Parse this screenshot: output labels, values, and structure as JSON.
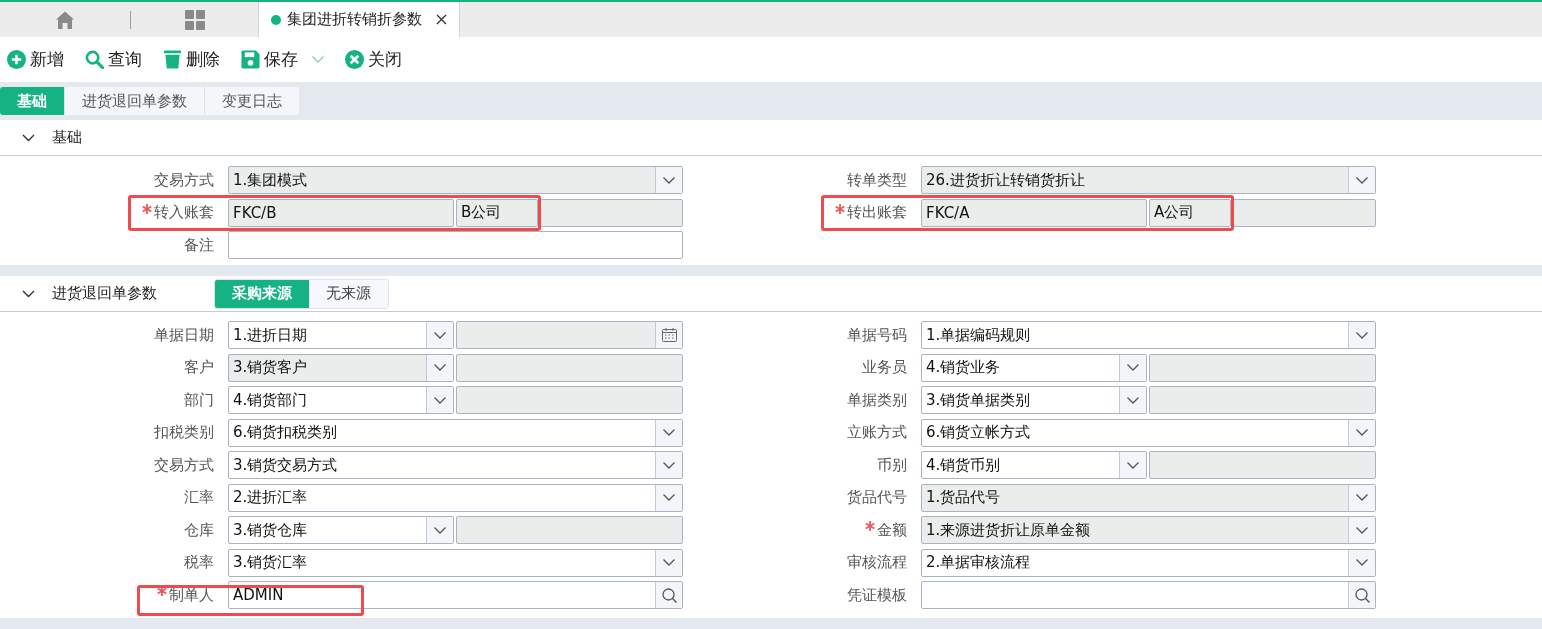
{
  "tab_bar": {
    "tabs": [
      {
        "title": "集团进折转销折参数",
        "selected": true
      }
    ]
  },
  "toolbar": [
    {
      "kind": "add",
      "label": "新增",
      "dropdown": false
    },
    {
      "kind": "search",
      "label": "查询",
      "dropdown": false
    },
    {
      "kind": "delete",
      "label": "删除",
      "dropdown": false
    },
    {
      "kind": "save",
      "label": "保存",
      "dropdown": true
    },
    {
      "kind": "close",
      "label": "关闭",
      "dropdown": false
    }
  ],
  "page_tabs": [
    {
      "label": "基础",
      "selected": true
    },
    {
      "label": "进货退回单参数",
      "selected": false
    },
    {
      "label": "变更日志",
      "selected": false
    }
  ],
  "sections": [
    {
      "title": "基础",
      "expanded": true,
      "left": [
        {
          "label": "交易方式",
          "kind": "select",
          "value": "1.集团模式",
          "readonly": true,
          "required": false,
          "highlighted": false
        },
        {
          "label": "转入账套",
          "kind": "account",
          "value": "FKC/B",
          "account_name": "B公司",
          "readonly": true,
          "required": true,
          "highlighted": true
        },
        {
          "label": "备注",
          "kind": "text",
          "readonly": false,
          "required": false,
          "highlighted": false
        }
      ],
      "right": [
        {
          "label": "转单类型",
          "kind": "select",
          "value": "26.进货折让转销货折让",
          "readonly": true,
          "required": false,
          "highlighted": false
        },
        {
          "label": "转出账套",
          "kind": "account",
          "value": "FKC/A",
          "account_name": "A公司",
          "readonly": true,
          "required": true,
          "highlighted": true
        }
      ]
    },
    {
      "title": "进货退回单参数",
      "expanded": true,
      "source_options": [
        {
          "label": "采购来源",
          "selected": true
        },
        {
          "label": "无来源",
          "selected": false
        }
      ],
      "left": [
        {
          "label": "单据日期",
          "kind": "date_select",
          "value": "1.进折日期",
          "readonly": false,
          "required": false,
          "highlighted": false
        },
        {
          "label": "客户",
          "kind": "select_input",
          "value": "3.销货客户",
          "readonly": true,
          "required": false,
          "highlighted": false
        },
        {
          "label": "部门",
          "kind": "select_input",
          "value": "4.销货部门",
          "readonly": false,
          "required": false,
          "highlighted": false
        },
        {
          "label": "扣税类别",
          "kind": "select",
          "value": "6.销货扣税类别",
          "readonly": false,
          "required": false,
          "highlighted": false
        },
        {
          "label": "交易方式",
          "kind": "select",
          "value": "3.销货交易方式",
          "readonly": false,
          "required": false,
          "highlighted": false
        },
        {
          "label": "汇率",
          "kind": "select",
          "value": "2.进折汇率",
          "readonly": false,
          "required": false,
          "highlighted": false
        },
        {
          "label": "仓库",
          "kind": "select_input",
          "value": "3.销货仓库",
          "readonly": false,
          "required": false,
          "highlighted": false
        },
        {
          "label": "税率",
          "kind": "select",
          "value": "3.销货汇率",
          "readonly": false,
          "required": false,
          "highlighted": false
        },
        {
          "label": "制单人",
          "kind": "lookup",
          "value": "ADMIN",
          "readonly": false,
          "required": true,
          "highlighted": true
        }
      ],
      "right": [
        {
          "label": "单据号码",
          "kind": "select",
          "value": "1.单据编码规则",
          "readonly": false,
          "required": false,
          "highlighted": false
        },
        {
          "label": "业务员",
          "kind": "select_input",
          "value": "4.销货业务",
          "readonly": false,
          "required": false,
          "highlighted": false
        },
        {
          "label": "单据类别",
          "kind": "select_input",
          "value": "3.销货单据类别",
          "readonly": false,
          "required": false,
          "highlighted": false
        },
        {
          "label": "立账方式",
          "kind": "select",
          "value": "6.销货立帐方式",
          "readonly": false,
          "required": false,
          "highlighted": false
        },
        {
          "label": "币别",
          "kind": "select_input",
          "value": "4.销货币别",
          "readonly": false,
          "required": false,
          "highlighted": false
        },
        {
          "label": "货品代号",
          "kind": "select",
          "value": "1.货品代号",
          "readonly": true,
          "required": false,
          "highlighted": false
        },
        {
          "label": "金额",
          "kind": "select",
          "value": "1.来源进货折让原单金额",
          "readonly": true,
          "required": true,
          "highlighted": false
        },
        {
          "label": "审核流程",
          "kind": "select",
          "value": "2.单据审核流程",
          "readonly": false,
          "required": false,
          "highlighted": false
        },
        {
          "label": "凭证模板",
          "kind": "lookup",
          "readonly": false,
          "required": false,
          "highlighted": false
        }
      ]
    }
  ]
}
